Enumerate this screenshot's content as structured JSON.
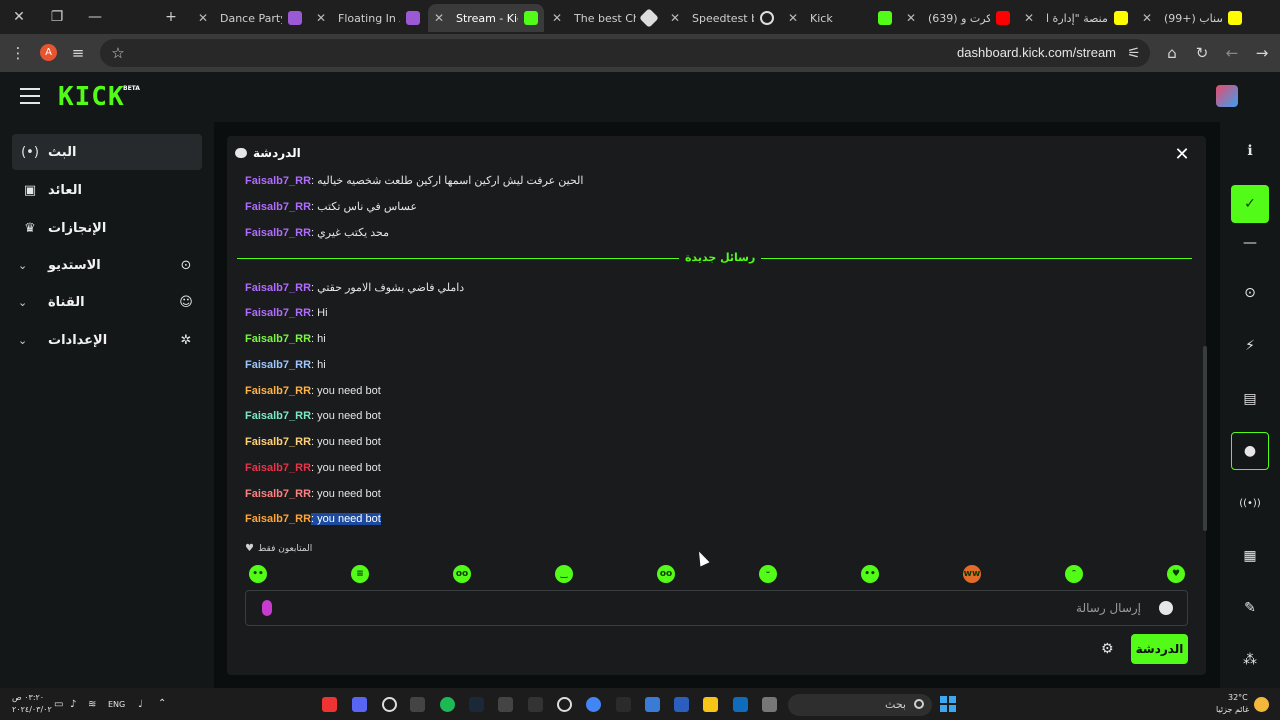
{
  "browser": {
    "tabs": [
      {
        "title": "Dance Party",
        "active": false
      },
      {
        "title": "Floating In A",
        "active": false
      },
      {
        "title": "Stream - Kick",
        "active": true
      },
      {
        "title": "The best Cha",
        "active": false
      },
      {
        "title": "Speedtest by",
        "active": false
      },
      {
        "title": "Kick",
        "active": false
      },
      {
        "title": "(639) تنكرت و",
        "active": false
      },
      {
        "title": "منصة \"إدارة ا",
        "active": false
      },
      {
        "title": "(99+) سناب",
        "active": false
      }
    ],
    "url": "dashboard.kick.com/stream",
    "profile_initial": "A",
    "close_glyph": "✕",
    "restore_glyph": "❐",
    "minimize_glyph": "—",
    "new_tab_glyph": "+"
  },
  "header": {
    "logo": "KICK",
    "logo_badge": "BETA"
  },
  "sidebar": {
    "items": [
      {
        "label": "البث",
        "icon": "broadcast-icon",
        "glyph": "(•)",
        "active": true,
        "chevron": false
      },
      {
        "label": "العائد",
        "icon": "revenue-icon",
        "glyph": "▣",
        "active": false,
        "chevron": false
      },
      {
        "label": "الإنجازات",
        "icon": "trophy-icon",
        "glyph": "♛",
        "active": false,
        "chevron": false
      },
      {
        "label": "الاستديو",
        "icon": "studio-icon",
        "glyph": "⊙",
        "active": false,
        "chevron": true
      },
      {
        "label": "القناة",
        "icon": "channel-icon",
        "glyph": "☺",
        "active": false,
        "chevron": true
      },
      {
        "label": "الإعدادات",
        "icon": "settings-icon",
        "glyph": "✲",
        "active": false,
        "chevron": true
      }
    ],
    "chevron_glyph": "⌄"
  },
  "chat": {
    "title": "الدردشة",
    "close_glyph": "✕",
    "divider_label": "رسائل جديدة",
    "messages_before": [
      {
        "user": "Faisalb7_RR",
        "text": "الحين عرفت ليش اركين اسمها اركين طلعت شخصيه خياليه",
        "color": "#b06cff"
      },
      {
        "user": "Faisalb7_RR",
        "text": "عساس في ناس تكتب",
        "color": "#b06cff"
      },
      {
        "user": "Faisalb7_RR",
        "text": "محد يكتب غيري",
        "color": "#b06cff"
      }
    ],
    "messages_after": [
      {
        "user": "Faisalb7_RR",
        "text": "داملي فاضي بشوف الامور حقتي",
        "color": "#b06cff",
        "selected": false
      },
      {
        "user": "Faisalb7_RR",
        "text": "Hi",
        "color": "#b06cff",
        "selected": false
      },
      {
        "user": "Faisalb7_RR",
        "text": "hi",
        "color": "#7bf542",
        "selected": false
      },
      {
        "user": "Faisalb7_RR",
        "text": "hi",
        "color": "#9fc5ff",
        "selected": false
      },
      {
        "user": "Faisalb7_RR",
        "text": "you need bot",
        "color": "#ffb347",
        "selected": false
      },
      {
        "user": "Faisalb7_RR",
        "text": "you need bot",
        "color": "#7de9c4",
        "selected": false
      },
      {
        "user": "Faisalb7_RR",
        "text": "you need bot",
        "color": "#ffd27a",
        "selected": false
      },
      {
        "user": "Faisalb7_RR",
        "text": "you need bot",
        "color": "#e8334a",
        "selected": false
      },
      {
        "user": "Faisalb7_RR",
        "text": "you need bot",
        "color": "#ff8080",
        "selected": false
      },
      {
        "user": "Faisalb7_RR",
        "text": "you need bot",
        "color": "#ffa53a",
        "selected": true
      }
    ],
    "followers_only": "المتابعون فقط",
    "emotes": [
      "emote-1",
      "emote-2",
      "emote-3",
      "emote-4",
      "emote-5",
      "emote-6",
      "emote-7",
      "emote-8",
      "emote-9",
      "emote-10"
    ],
    "input_placeholder": "إرسال رسالة",
    "send_label": "الدردشة",
    "settings_glyph": "⚙"
  },
  "right_sidebar": {
    "buttons": [
      {
        "name": "info-icon",
        "glyph": "ℹ",
        "style": "plain"
      },
      {
        "name": "check-icon",
        "glyph": "✓",
        "style": "green"
      },
      {
        "name": "minus-icon",
        "glyph": "—",
        "style": "plain"
      },
      {
        "name": "camera-icon",
        "glyph": "⊙",
        "style": "plain"
      },
      {
        "name": "lightning-icon",
        "glyph": "⚡",
        "style": "plain"
      },
      {
        "name": "document-icon",
        "glyph": "▤",
        "style": "plain"
      },
      {
        "name": "chat-bubble-icon",
        "glyph": "●",
        "style": "outlined"
      },
      {
        "name": "broadcast-icon",
        "glyph": "((•))",
        "style": "plain"
      },
      {
        "name": "layout-icon",
        "glyph": "▦",
        "style": "plain"
      },
      {
        "name": "wrench-icon",
        "glyph": "✎",
        "style": "plain"
      },
      {
        "name": "share-icon",
        "glyph": "⁂",
        "style": "plain"
      }
    ]
  },
  "taskbar": {
    "time": "٠٣:٢٠ ص",
    "date": "٢٠٢٤/٠٣/٠٢",
    "language": "ENG",
    "search_placeholder": "بحث",
    "weather_temp": "32°C",
    "weather_desc": "غائم جزئيا"
  }
}
